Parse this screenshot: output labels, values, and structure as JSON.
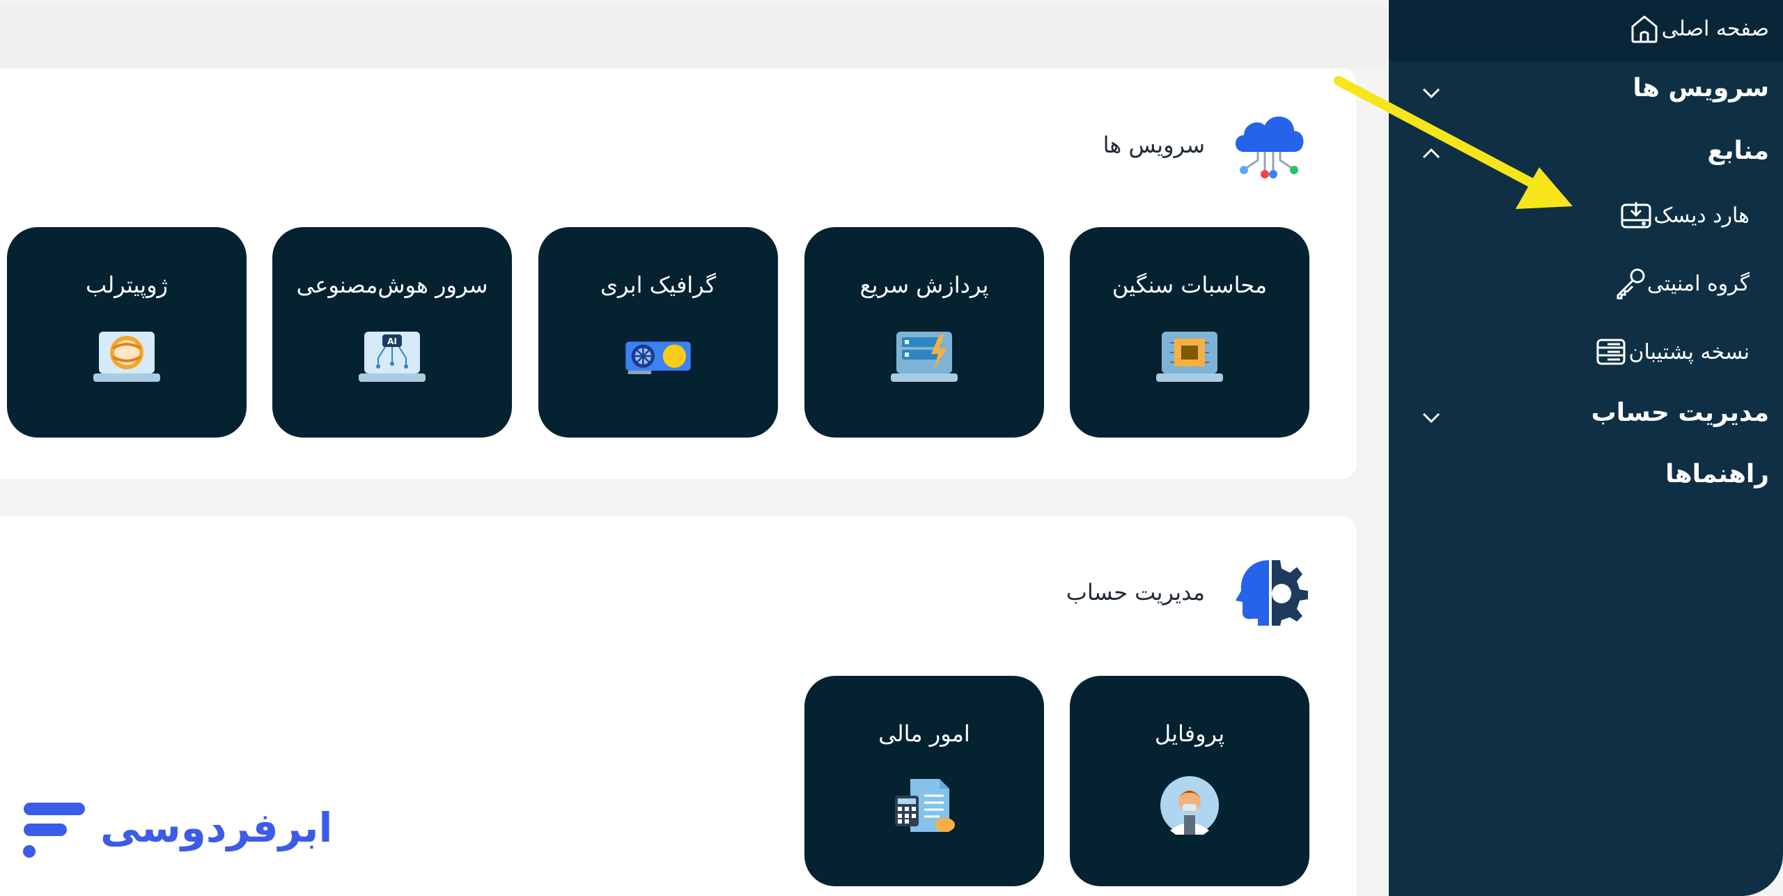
{
  "sidebar": {
    "home": {
      "label": "صفحه اصلی",
      "icon": "home-icon"
    },
    "services": {
      "label": "سرویس ها",
      "expanded": false
    },
    "resources": {
      "label": "منابع",
      "expanded": true,
      "items": [
        {
          "label": "هارد دیسک",
          "icon": "hard-disk-icon"
        },
        {
          "label": "گروه امنیتی",
          "icon": "key-icon"
        },
        {
          "label": "نسخه پشتیبان",
          "icon": "backup-server-icon"
        }
      ]
    },
    "account_management": {
      "label": "مدیریت حساب",
      "expanded": false
    },
    "guides": {
      "label": "راهنماها"
    }
  },
  "services_section": {
    "title": "سرویس ها",
    "icon": "cloud-network-icon",
    "cards": [
      {
        "label": "محاسبات سنگین",
        "icon": "cpu-chip-icon"
      },
      {
        "label": "پردازش سریع",
        "icon": "fast-server-icon"
      },
      {
        "label": "گرافیک ابری",
        "icon": "gpu-card-icon"
      },
      {
        "label": "سرور هوش‌مصنوعی",
        "icon": "ai-laptop-icon"
      },
      {
        "label": "ژوپیترلب",
        "icon": "jupyter-laptop-icon"
      }
    ]
  },
  "account_section": {
    "title": "مدیریت حساب",
    "icon": "head-gear-icon",
    "cards": [
      {
        "label": "پروفایل",
        "icon": "user-avatar-icon"
      },
      {
        "label": "امور مالی",
        "icon": "invoice-calculator-icon"
      }
    ]
  },
  "brand": {
    "name": "ابرفردوسی",
    "color": "#3b5be8"
  },
  "colors": {
    "sidebar_bg": "#0f3044",
    "sidebar_active": "#082637",
    "card_bg": "#052231",
    "arrow": "#f7e51b"
  }
}
